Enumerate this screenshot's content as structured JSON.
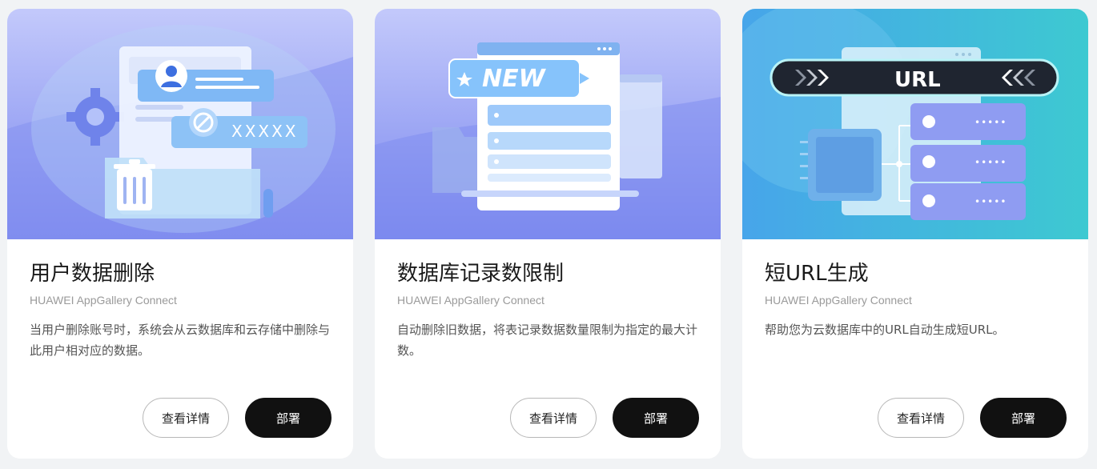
{
  "colors": {
    "page_bg": "#f1f3f5",
    "primary_button_bg": "#111111",
    "banner1": "#8b97f2",
    "banner2": "#8b97f2",
    "banner3": "#3db9e0"
  },
  "cards": [
    {
      "title": "用户数据删除",
      "vendor": "HUAWEI AppGallery Connect",
      "description": "当用户删除账号时，系统会从云数据库和云存储中删除与此用户相对应的数据。",
      "details_label": "查看详情",
      "deploy_label": "部署",
      "banner_text": "XXXXX"
    },
    {
      "title": "数据库记录数限制",
      "vendor": "HUAWEI AppGallery Connect",
      "description": "自动删除旧数据，将表记录数据数量限制为指定的最大计数。",
      "details_label": "查看详情",
      "deploy_label": "部署",
      "banner_text": "NEW"
    },
    {
      "title": "短URL生成",
      "vendor": "HUAWEI AppGallery Connect",
      "description": "帮助您为云数据库中的URL自动生成短URL。",
      "details_label": "查看详情",
      "deploy_label": "部署",
      "banner_text": "URL"
    }
  ]
}
